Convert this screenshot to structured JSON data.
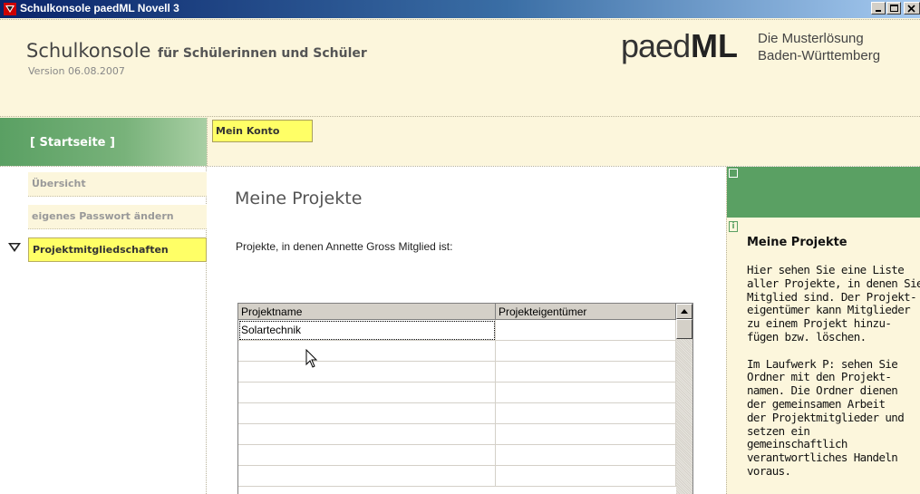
{
  "window": {
    "title": "Schulkonsole paedML Novell 3",
    "buttons": [
      "minimize-icon",
      "maximize-icon",
      "close-icon"
    ]
  },
  "header": {
    "app_name": "Schulkonsole",
    "app_subtitle": "für Schülerinnen und Schüler",
    "version": "Version 06.08.2007",
    "logo_light": "paed",
    "logo_bold": "ML",
    "tagline_1": "Die Musterlösung",
    "tagline_2": "Baden-Württemberg"
  },
  "nav": {
    "home_label": "[ Startseite ]",
    "top_tab": "Mein Konto"
  },
  "sidebar": {
    "items": [
      {
        "label": "Übersicht",
        "active": false
      },
      {
        "label": "eigenes Passwort ändern",
        "active": false
      },
      {
        "label": "Projektmitgliedschaften",
        "active": true
      }
    ]
  },
  "main": {
    "title": "Meine Projekte",
    "intro": "Projekte, in denen Annette Gross Mitglied ist:",
    "table": {
      "columns": [
        "Projektname",
        "Projekteigentümer"
      ],
      "rows": [
        [
          "Solartechnik",
          ""
        ]
      ]
    }
  },
  "info_panel": {
    "title": "Meine Projekte",
    "body": "Hier sehen Sie eine Liste\naller Projekte, in denen Sie\nMitglied sind. Der Projekt-\neigentümer kann Mitglieder\nzu einem Projekt hinzu-\nfügen bzw. löschen.\n\nIm Laufwerk P: sehen Sie\nOrdner mit den Projekt-\nnamen. Die Ordner dienen\nder gemeinsamen Arbeit\nder Projektmitglieder und\nsetzen ein\ngemeinschaftlich\nverantwortliches Handeln\nvoraus."
  },
  "colors": {
    "header_bg": "#fcf6dc",
    "accent_green": "#5aa063",
    "highlight_yellow": "#ffff66"
  }
}
